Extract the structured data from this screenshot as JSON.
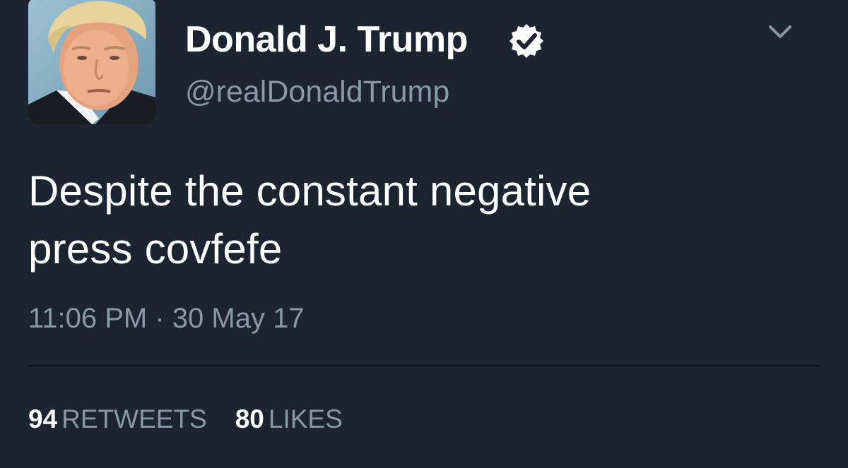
{
  "tweet": {
    "display_name": "Donald J. Trump",
    "handle": "@realDonaldTrump",
    "verified": true,
    "text_lines": [
      "Despite the constant negative",
      "press covfefe"
    ],
    "timestamp": "11:06 PM · 30 May 17",
    "retweets": {
      "count": "94",
      "label": "RETWEETS"
    },
    "likes": {
      "count": "80",
      "label": "LIKES"
    }
  },
  "icons": {
    "verified": "verified-badge-icon",
    "menu": "chevron-down-icon"
  },
  "colors": {
    "background": "#1b2430",
    "primary_text": "#ffffff",
    "secondary_text": "#8899a6",
    "divider": "#0b1118"
  }
}
